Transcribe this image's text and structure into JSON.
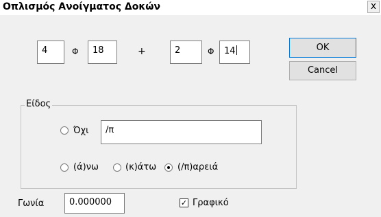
{
  "window": {
    "title": "Οπλισμός Ανοίγματος Δοκών",
    "close_glyph": "x"
  },
  "rebar": {
    "count1": "4",
    "phi1": "Φ",
    "diameter1": "18",
    "plus": "+",
    "count2": "2",
    "phi2": "Φ",
    "diameter2": "14"
  },
  "buttons": {
    "ok": "OK",
    "cancel": "Cancel"
  },
  "type_group": {
    "legend": "Είδος",
    "none_label": "Όχι",
    "none_value": "/π",
    "up_label": "(ά)νω",
    "down_label": "(κ)άτω",
    "both_label": "(/π)αρειά",
    "selected": "both"
  },
  "angle": {
    "label": "Γωνία",
    "value": "0.000000"
  },
  "graphic": {
    "label": "Γραφικό",
    "checked": true
  }
}
